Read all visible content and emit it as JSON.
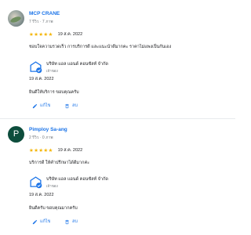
{
  "reviews": [
    {
      "name": "MCP CRANE",
      "meta": "7 รีวิว · 7 ภาพ",
      "stars": "★★★★★",
      "date": "19 ส.ค. 2022",
      "text": "ชอบใจความรวดเร็ว การบริการดี และแนะนำดีมากคะ ราคาไม่แพงเป็นกันเอง",
      "owner_name": "บริษัท แอล แอนด์ คอนซัลท์ จำกัด",
      "owner_role": "เจ้าของ",
      "reply_date": "19 ส.ค. 2022",
      "reply_text": "ยินดีให้บริการ ขอบคุณครับ",
      "edit_label": "แก้ไข",
      "delete_label": "ลบ"
    },
    {
      "avatar_letter": "P",
      "name": "Pimploy Sa-ang",
      "meta": "2 รีวิว · 0 ภาพ",
      "stars": "★★★★★",
      "date": "19 ส.ค. 2022",
      "text": "บริการดี ให้คำปรึกษาได้ดีมากค่ะ",
      "owner_name": "บริษัท แอล แอนด์ คอนซัลท์ จำกัด",
      "owner_role": "เจ้าของ",
      "reply_date": "19 ส.ค. 2022",
      "reply_text": "ยินดีครับ ขอบคุณมากครับ",
      "edit_label": "แก้ไข",
      "delete_label": "ลบ"
    }
  ],
  "colors": {
    "link": "#1a73e8",
    "star": "#f4b400",
    "avatar2": "#0d4d3c"
  }
}
